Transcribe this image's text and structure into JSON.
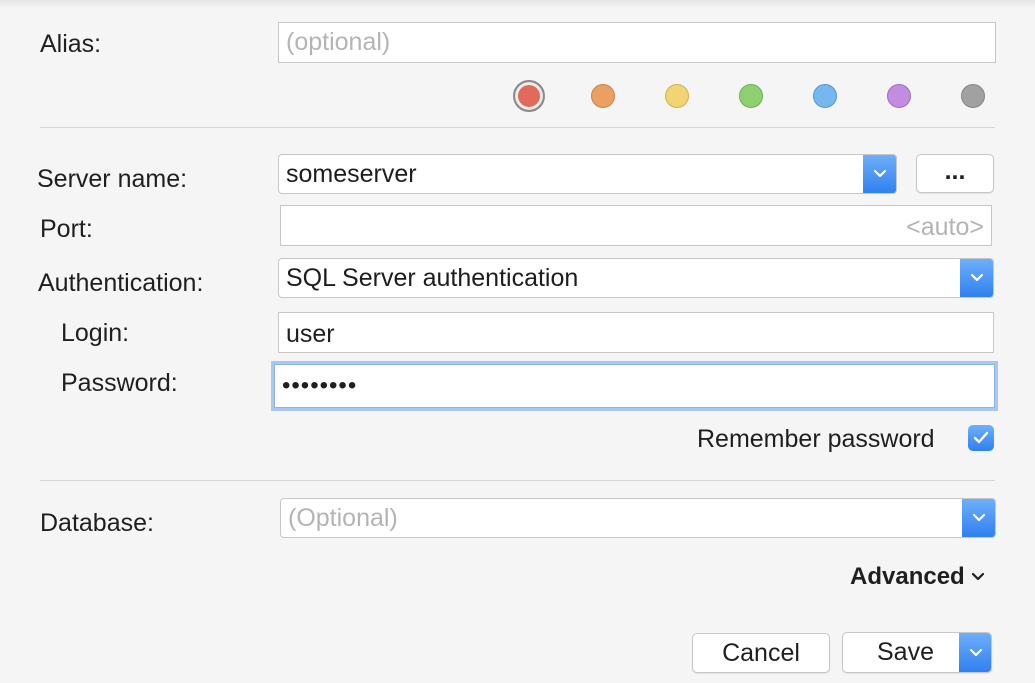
{
  "alias": {
    "label": "Alias:",
    "placeholder": "(optional)"
  },
  "colors": {
    "swatches": [
      {
        "name": "red",
        "hex": "#e06a5c",
        "selected": true
      },
      {
        "name": "orange",
        "hex": "#eba062"
      },
      {
        "name": "yellow",
        "hex": "#f2d572"
      },
      {
        "name": "green",
        "hex": "#8fd171"
      },
      {
        "name": "blue",
        "hex": "#76b6f1"
      },
      {
        "name": "purple",
        "hex": "#c28ce0"
      },
      {
        "name": "gray",
        "hex": "#a1a1a1"
      }
    ]
  },
  "server": {
    "label": "Server name:",
    "value": "someserver",
    "browse_label": "..."
  },
  "port": {
    "label": "Port:",
    "placeholder": "<auto>"
  },
  "authentication": {
    "label": "Authentication:",
    "value": "SQL Server authentication"
  },
  "login": {
    "label": "Login:",
    "value": "user"
  },
  "password": {
    "label": "Password:",
    "value": "••••••••"
  },
  "remember": {
    "label": "Remember password",
    "checked": true
  },
  "database": {
    "label": "Database:",
    "placeholder": "(Optional)"
  },
  "advanced": {
    "label": "Advanced"
  },
  "buttons": {
    "cancel": "Cancel",
    "save": "Save"
  },
  "accent": "#2f7ff1"
}
